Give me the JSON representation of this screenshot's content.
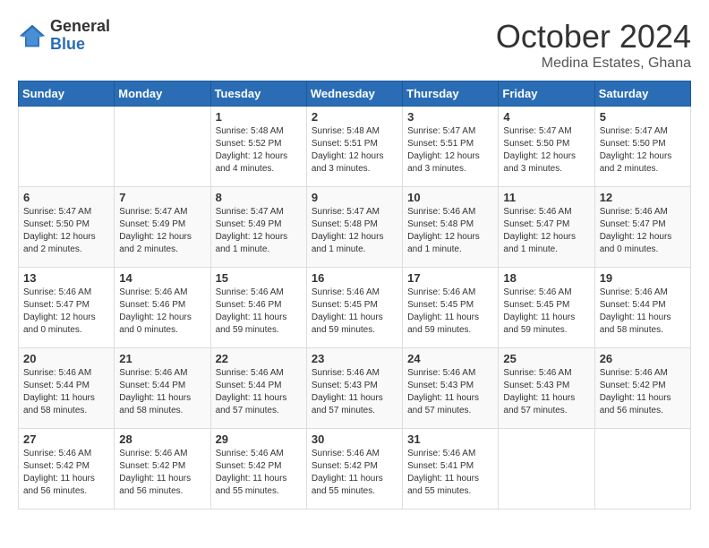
{
  "header": {
    "logo_general": "General",
    "logo_blue": "Blue",
    "month_title": "October 2024",
    "location": "Medina Estates, Ghana"
  },
  "weekdays": [
    "Sunday",
    "Monday",
    "Tuesday",
    "Wednesday",
    "Thursday",
    "Friday",
    "Saturday"
  ],
  "weeks": [
    [
      {
        "day": "",
        "info": ""
      },
      {
        "day": "",
        "info": ""
      },
      {
        "day": "1",
        "info": "Sunrise: 5:48 AM\nSunset: 5:52 PM\nDaylight: 12 hours and 4 minutes."
      },
      {
        "day": "2",
        "info": "Sunrise: 5:48 AM\nSunset: 5:51 PM\nDaylight: 12 hours and 3 minutes."
      },
      {
        "day": "3",
        "info": "Sunrise: 5:47 AM\nSunset: 5:51 PM\nDaylight: 12 hours and 3 minutes."
      },
      {
        "day": "4",
        "info": "Sunrise: 5:47 AM\nSunset: 5:50 PM\nDaylight: 12 hours and 3 minutes."
      },
      {
        "day": "5",
        "info": "Sunrise: 5:47 AM\nSunset: 5:50 PM\nDaylight: 12 hours and 2 minutes."
      }
    ],
    [
      {
        "day": "6",
        "info": "Sunrise: 5:47 AM\nSunset: 5:50 PM\nDaylight: 12 hours and 2 minutes."
      },
      {
        "day": "7",
        "info": "Sunrise: 5:47 AM\nSunset: 5:49 PM\nDaylight: 12 hours and 2 minutes."
      },
      {
        "day": "8",
        "info": "Sunrise: 5:47 AM\nSunset: 5:49 PM\nDaylight: 12 hours and 1 minute."
      },
      {
        "day": "9",
        "info": "Sunrise: 5:47 AM\nSunset: 5:48 PM\nDaylight: 12 hours and 1 minute."
      },
      {
        "day": "10",
        "info": "Sunrise: 5:46 AM\nSunset: 5:48 PM\nDaylight: 12 hours and 1 minute."
      },
      {
        "day": "11",
        "info": "Sunrise: 5:46 AM\nSunset: 5:47 PM\nDaylight: 12 hours and 1 minute."
      },
      {
        "day": "12",
        "info": "Sunrise: 5:46 AM\nSunset: 5:47 PM\nDaylight: 12 hours and 0 minutes."
      }
    ],
    [
      {
        "day": "13",
        "info": "Sunrise: 5:46 AM\nSunset: 5:47 PM\nDaylight: 12 hours and 0 minutes."
      },
      {
        "day": "14",
        "info": "Sunrise: 5:46 AM\nSunset: 5:46 PM\nDaylight: 12 hours and 0 minutes."
      },
      {
        "day": "15",
        "info": "Sunrise: 5:46 AM\nSunset: 5:46 PM\nDaylight: 11 hours and 59 minutes."
      },
      {
        "day": "16",
        "info": "Sunrise: 5:46 AM\nSunset: 5:45 PM\nDaylight: 11 hours and 59 minutes."
      },
      {
        "day": "17",
        "info": "Sunrise: 5:46 AM\nSunset: 5:45 PM\nDaylight: 11 hours and 59 minutes."
      },
      {
        "day": "18",
        "info": "Sunrise: 5:46 AM\nSunset: 5:45 PM\nDaylight: 11 hours and 59 minutes."
      },
      {
        "day": "19",
        "info": "Sunrise: 5:46 AM\nSunset: 5:44 PM\nDaylight: 11 hours and 58 minutes."
      }
    ],
    [
      {
        "day": "20",
        "info": "Sunrise: 5:46 AM\nSunset: 5:44 PM\nDaylight: 11 hours and 58 minutes."
      },
      {
        "day": "21",
        "info": "Sunrise: 5:46 AM\nSunset: 5:44 PM\nDaylight: 11 hours and 58 minutes."
      },
      {
        "day": "22",
        "info": "Sunrise: 5:46 AM\nSunset: 5:44 PM\nDaylight: 11 hours and 57 minutes."
      },
      {
        "day": "23",
        "info": "Sunrise: 5:46 AM\nSunset: 5:43 PM\nDaylight: 11 hours and 57 minutes."
      },
      {
        "day": "24",
        "info": "Sunrise: 5:46 AM\nSunset: 5:43 PM\nDaylight: 11 hours and 57 minutes."
      },
      {
        "day": "25",
        "info": "Sunrise: 5:46 AM\nSunset: 5:43 PM\nDaylight: 11 hours and 57 minutes."
      },
      {
        "day": "26",
        "info": "Sunrise: 5:46 AM\nSunset: 5:42 PM\nDaylight: 11 hours and 56 minutes."
      }
    ],
    [
      {
        "day": "27",
        "info": "Sunrise: 5:46 AM\nSunset: 5:42 PM\nDaylight: 11 hours and 56 minutes."
      },
      {
        "day": "28",
        "info": "Sunrise: 5:46 AM\nSunset: 5:42 PM\nDaylight: 11 hours and 56 minutes."
      },
      {
        "day": "29",
        "info": "Sunrise: 5:46 AM\nSunset: 5:42 PM\nDaylight: 11 hours and 55 minutes."
      },
      {
        "day": "30",
        "info": "Sunrise: 5:46 AM\nSunset: 5:42 PM\nDaylight: 11 hours and 55 minutes."
      },
      {
        "day": "31",
        "info": "Sunrise: 5:46 AM\nSunset: 5:41 PM\nDaylight: 11 hours and 55 minutes."
      },
      {
        "day": "",
        "info": ""
      },
      {
        "day": "",
        "info": ""
      }
    ]
  ]
}
